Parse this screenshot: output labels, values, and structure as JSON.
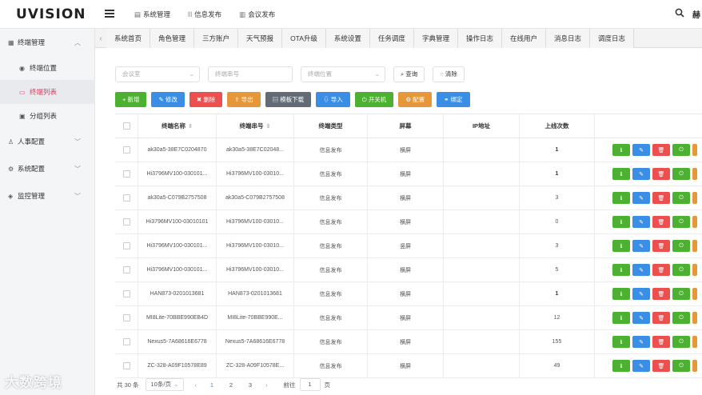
{
  "app": {
    "logo": "UVISION",
    "user_initial": "赫"
  },
  "topnav": [
    {
      "icon": "chart-icon",
      "label": "系统管理"
    },
    {
      "icon": "tree-icon",
      "label": "信息发布"
    },
    {
      "icon": "meeting-icon",
      "label": "会议发布"
    }
  ],
  "sidebar": {
    "groups": [
      {
        "label": "终端管理",
        "expanded": true
      },
      {
        "label": "人事配置"
      },
      {
        "label": "系统配置"
      },
      {
        "label": "监控管理"
      }
    ],
    "items": [
      {
        "label": "终端位置"
      },
      {
        "label": "终端列表",
        "active": true
      },
      {
        "label": "分组列表"
      }
    ]
  },
  "tabs": [
    "系统首页",
    "角色管理",
    "三方账户",
    "天气预报",
    "OTA升级",
    "系统设置",
    "任务调度",
    "字典管理",
    "操作日志",
    "在线用户",
    "消息日志",
    "调度日志"
  ],
  "filters": {
    "meeting_placeholder": "会议室",
    "serial_placeholder": "终端串号",
    "location_placeholder": "终端位置",
    "query_label": "查询",
    "clear_label": "清除"
  },
  "actions": {
    "add": "新增",
    "edit": "修改",
    "delete": "删除",
    "export": "导出",
    "template": "模板下载",
    "import": "导入",
    "power": "开关机",
    "config": "配置",
    "bind": "绑定"
  },
  "table": {
    "headers": [
      "终端名称",
      "终端串号",
      "终端类型",
      "屏幕",
      "IP地址",
      "上线次数"
    ],
    "rows": [
      {
        "name": "ak30a5-38E7C0204870",
        "serial": "ak30a5-38E7C02048...",
        "type": "信息发布",
        "screen": "横屏",
        "ip": "",
        "count": "1"
      },
      {
        "name": "Hi3796MV100-030101...",
        "serial": "Hi3796MV100-03010...",
        "type": "信息发布",
        "screen": "横屏",
        "ip": "",
        "count": "1"
      },
      {
        "name": "ak30a5-C079B2757508",
        "serial": "ak30a5-C079B2757508",
        "type": "信息发布",
        "screen": "横屏",
        "ip": "",
        "count": "3"
      },
      {
        "name": "Hi3796MV100-03010101",
        "serial": "Hi3796MV100-03010...",
        "type": "信息发布",
        "screen": "横屏",
        "ip": "",
        "count": "0"
      },
      {
        "name": "Hi3796MV100-030101...",
        "serial": "Hi3796MV100-03010...",
        "type": "信息发布",
        "screen": "竖屏",
        "ip": "",
        "count": "3"
      },
      {
        "name": "Hi3796MV100-030101...",
        "serial": "Hi3796MV100-03010...",
        "type": "信息发布",
        "screen": "横屏",
        "ip": "",
        "count": "5"
      },
      {
        "name": "HAN873-0201013681",
        "serial": "HAN873-0201013681",
        "type": "信息发布",
        "screen": "横屏",
        "ip": "",
        "count": "1"
      },
      {
        "name": "MI8Lite-70BBE990EB4D",
        "serial": "MI8Lite-70BBE990E...",
        "type": "信息发布",
        "screen": "横屏",
        "ip": "",
        "count": "12"
      },
      {
        "name": "Nexus5-7A68616E6778",
        "serial": "Nexus5-7A68616E6778",
        "type": "信息发布",
        "screen": "横屏",
        "ip": "",
        "count": "155"
      },
      {
        "name": "ZC-328-A09F10578E89",
        "serial": "ZC-328-A09F10578E...",
        "type": "信息发布",
        "screen": "横屏",
        "ip": "",
        "count": "49"
      }
    ]
  },
  "pager": {
    "total": "共 30 条",
    "page_size": "10条/页",
    "pages": [
      "1",
      "2",
      "3"
    ],
    "goto_label": "前往",
    "goto_value": "1",
    "page_suffix": "页"
  },
  "watermark": "大数跨境",
  "colors": {
    "accent": "#e6345f",
    "green": "#4cb030",
    "blue": "#3a8ee6",
    "red": "#ed4e4e",
    "orange": "#e6973a",
    "gray": "#636b75"
  }
}
